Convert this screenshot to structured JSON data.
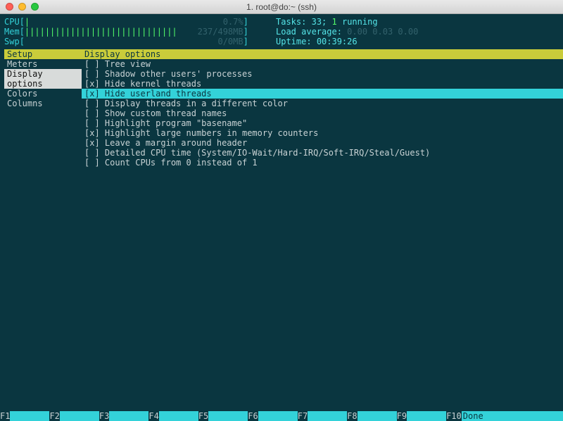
{
  "titlebar": {
    "title": "1. root@do:~ (ssh)"
  },
  "meters": {
    "cpu": {
      "label": "CPU",
      "bar": "|",
      "value": "0.7%"
    },
    "mem": {
      "label": "Mem",
      "bar": "||||||||||||||||||||||||||||||",
      "value": "237/498MB"
    },
    "swp": {
      "label": "Swp",
      "bar": "",
      "value": "0/0MB"
    }
  },
  "sysinfo": {
    "tasks_label": "Tasks:",
    "tasks_value": "33;",
    "running_count": "1",
    "running_label": "running",
    "load_label": "Load average:",
    "load_values": "0.00 0.03 0.00",
    "uptime_label": "Uptime:",
    "uptime_value": "00:39:26"
  },
  "sidebar": {
    "header": "Setup",
    "items": [
      "Meters",
      "Display options",
      "Colors",
      "Columns"
    ],
    "selected_index": 1
  },
  "display_options": {
    "header": "Display options",
    "selected_index": 3,
    "options": [
      {
        "checked": false,
        "label": "Tree view"
      },
      {
        "checked": false,
        "label": "Shadow other users' processes"
      },
      {
        "checked": true,
        "label": "Hide kernel threads"
      },
      {
        "checked": true,
        "label": "Hide userland threads"
      },
      {
        "checked": false,
        "label": "Display threads in a different color"
      },
      {
        "checked": false,
        "label": "Show custom thread names"
      },
      {
        "checked": false,
        "label": "Highlight program \"basename\""
      },
      {
        "checked": true,
        "label": "Highlight large numbers in memory counters"
      },
      {
        "checked": true,
        "label": "Leave a margin around header"
      },
      {
        "checked": false,
        "label": "Detailed CPU time (System/IO-Wait/Hard-IRQ/Soft-IRQ/Steal/Guest)"
      },
      {
        "checked": false,
        "label": "Count CPUs from 0 instead of 1"
      }
    ]
  },
  "fnkeys": [
    {
      "key": "F1",
      "label": ""
    },
    {
      "key": "F2",
      "label": ""
    },
    {
      "key": "F3",
      "label": ""
    },
    {
      "key": "F4",
      "label": ""
    },
    {
      "key": "F5",
      "label": ""
    },
    {
      "key": "F6",
      "label": ""
    },
    {
      "key": "F7",
      "label": ""
    },
    {
      "key": "F8",
      "label": ""
    },
    {
      "key": "F9",
      "label": ""
    },
    {
      "key": "F10",
      "label": "Done"
    }
  ]
}
